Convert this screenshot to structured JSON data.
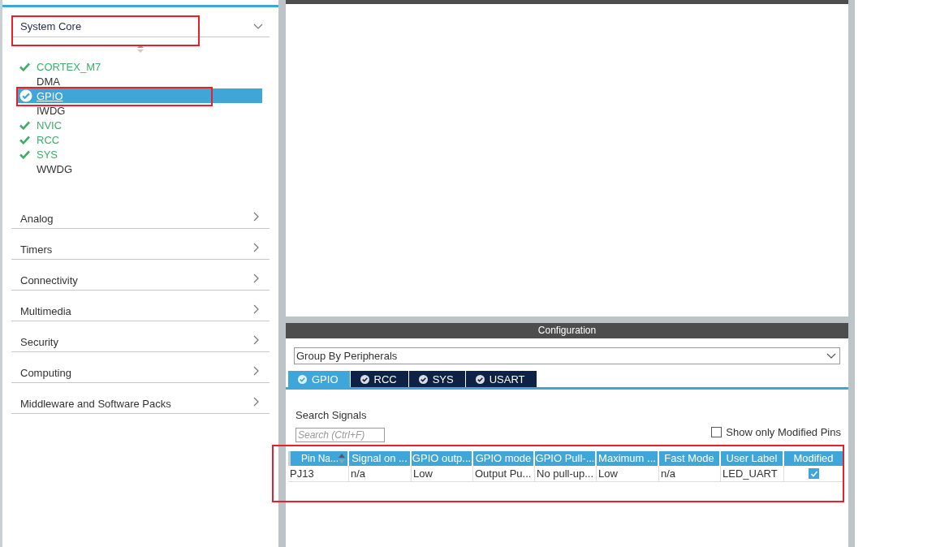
{
  "sidebar": {
    "section": {
      "title": "System Core",
      "expanded": true,
      "items": [
        {
          "label": "CORTEX_M7",
          "checked": true,
          "selected": false
        },
        {
          "label": "DMA",
          "checked": false,
          "selected": false
        },
        {
          "label": "GPIO",
          "checked": true,
          "selected": true
        },
        {
          "label": "IWDG",
          "checked": false,
          "selected": false
        },
        {
          "label": "NVIC",
          "checked": true,
          "selected": false
        },
        {
          "label": "RCC",
          "checked": true,
          "selected": false
        },
        {
          "label": "SYS",
          "checked": true,
          "selected": false
        },
        {
          "label": "WWDG",
          "checked": false,
          "selected": false
        }
      ]
    },
    "categories": [
      {
        "label": "Analog"
      },
      {
        "label": "Timers"
      },
      {
        "label": "Connectivity"
      },
      {
        "label": "Multimedia"
      },
      {
        "label": "Security"
      },
      {
        "label": "Computing"
      },
      {
        "label": "Middleware and Software Packs"
      }
    ]
  },
  "configuration": {
    "title": "Configuration",
    "group_by": "Group By Peripherals",
    "tabs": [
      {
        "label": "GPIO",
        "selected": true
      },
      {
        "label": "RCC",
        "selected": false
      },
      {
        "label": "SYS",
        "selected": false
      },
      {
        "label": "USART",
        "selected": false
      }
    ],
    "search_label": "Search Signals",
    "search_placeholder": "Search (Ctrl+F)",
    "show_modified": {
      "label": "Show only Modified Pins",
      "checked": false
    },
    "table": {
      "columns": [
        {
          "label": "Pin Na...",
          "sorted": true
        },
        {
          "label": "Signal on ...",
          "sorted": false
        },
        {
          "label": "GPIO outp...",
          "sorted": false
        },
        {
          "label": "GPIO mode",
          "sorted": false
        },
        {
          "label": "GPIO Pull-...",
          "sorted": false
        },
        {
          "label": "Maximum ...",
          "sorted": false
        },
        {
          "label": "Fast Mode",
          "sorted": false
        },
        {
          "label": "User Label",
          "sorted": false
        },
        {
          "label": "Modified",
          "sorted": false
        }
      ],
      "rows": [
        {
          "cells": [
            "PJ13",
            "n/a",
            "Low",
            "Output Pu...",
            "No pull-up...",
            "Low",
            "n/a",
            "LED_UART"
          ],
          "modified": true
        }
      ]
    }
  }
}
